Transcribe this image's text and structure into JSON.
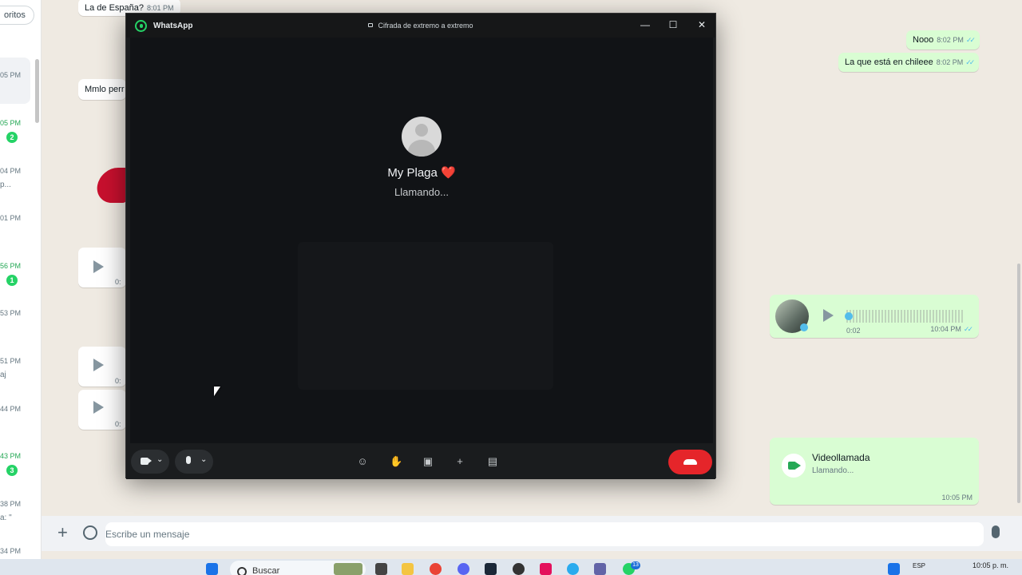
{
  "chat_list": {
    "favorites_label": "oritos",
    "items": [
      {
        "time": "05 PM",
        "snippet": "",
        "badge": "",
        "unread": false
      },
      {
        "time": "05 PM",
        "snippet": "",
        "badge": "2",
        "unread": true
      },
      {
        "time": "04 PM",
        "snippet": "p...",
        "badge": "",
        "unread": false
      },
      {
        "time": "01 PM",
        "snippet": "",
        "badge": "",
        "unread": false
      },
      {
        "time": "56 PM",
        "snippet": "",
        "badge": "1",
        "unread": true
      },
      {
        "time": "53 PM",
        "snippet": "",
        "badge": "",
        "unread": false
      },
      {
        "time": "51 PM",
        "snippet": "aj",
        "badge": "",
        "unread": false
      },
      {
        "time": "44 PM",
        "snippet": "",
        "badge": "",
        "unread": false
      },
      {
        "time": "43 PM",
        "snippet": "",
        "badge": "3",
        "unread": true
      },
      {
        "time": "38 PM",
        "snippet": "a: \"",
        "badge": "",
        "unread": false
      },
      {
        "time": "34 PM",
        "snippet": "",
        "badge": "",
        "unread": false
      }
    ]
  },
  "chat": {
    "incoming": [
      {
        "text": "La de España?",
        "time": "8:01 PM"
      },
      {
        "text": "Mmlo perr",
        "time": ""
      }
    ],
    "audio_times": [
      "0:",
      "0:",
      "0:"
    ],
    "outgoing": [
      {
        "text": "Nooo",
        "time": "8:02 PM"
      },
      {
        "text": "La que está en chileee",
        "time": "8:02 PM"
      }
    ],
    "voice_note": {
      "duration": "0:02",
      "time": "10:04 PM",
      "progress": 0.0
    },
    "video_call": {
      "title": "Videollamada",
      "status": "Llamando...",
      "time": "10:05 PM"
    }
  },
  "compose": {
    "placeholder": "Escribe un mensaje"
  },
  "call_window": {
    "app_name": "WhatsApp",
    "encryption": "Cifrada de extremo a extremo",
    "min_icon": "—",
    "max_icon": "☐",
    "close_icon": "✕",
    "contact_name": "My Plaga ❤️",
    "status": "Llamando...",
    "controls": {
      "chevron": "⌄",
      "emoji": "☺",
      "hand": "✋",
      "share": "▣",
      "add_person": "+",
      "chat": "▤"
    }
  },
  "taskbar": {
    "search_label": "Buscar",
    "language": "ESP",
    "clock_time": "10:05 p. m.",
    "badge": "13"
  },
  "colors": {
    "accent": "#25d366",
    "outgoing_bubble": "#d9fdd3",
    "end_call": "#e5252a",
    "ticks": "#53bdeb"
  }
}
